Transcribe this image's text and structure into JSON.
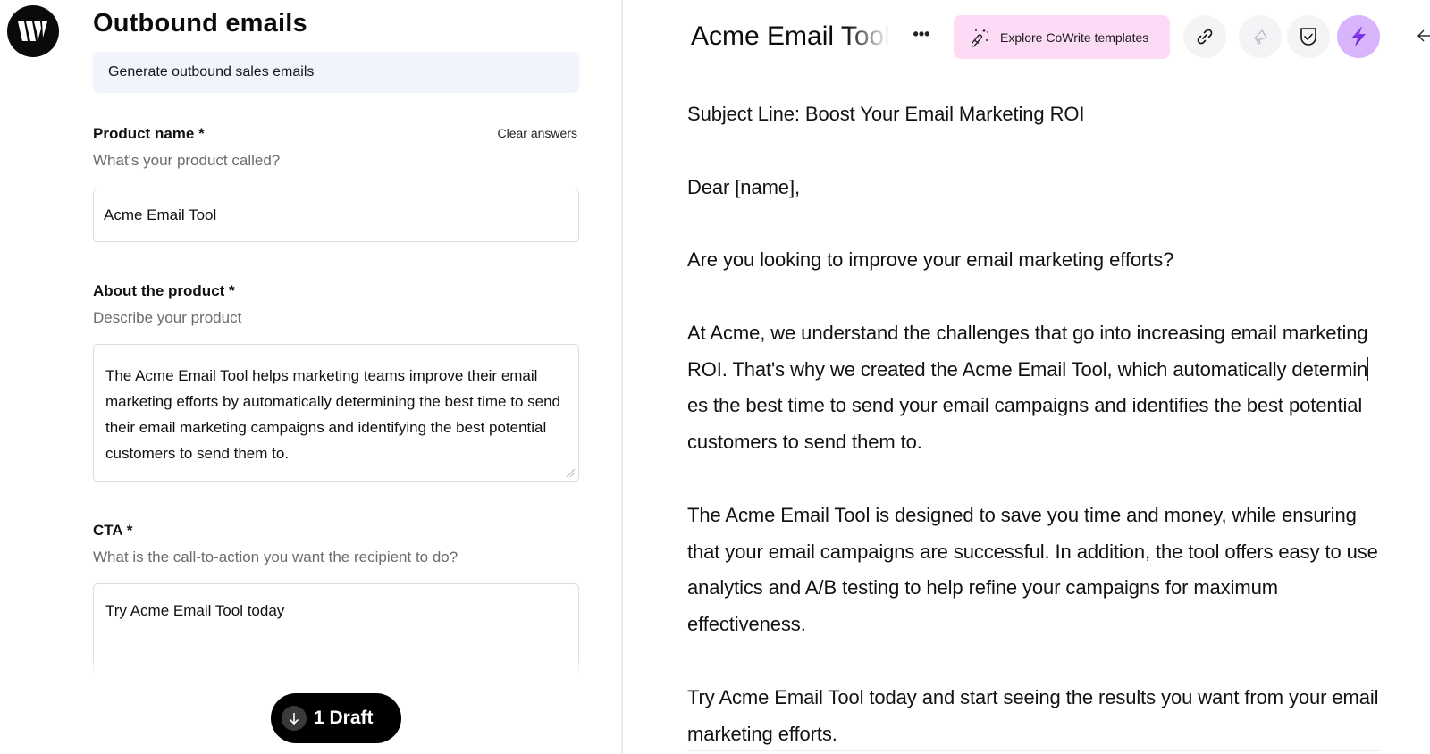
{
  "app": {
    "logo_letter": "W"
  },
  "left_panel": {
    "title": "Outbound emails",
    "description": "Generate outbound sales emails",
    "clear_answers_label": "Clear answers",
    "fields": [
      {
        "label": "Product name *",
        "hint": "What's your product called?",
        "value": "Acme Email Tool"
      },
      {
        "label": "About the product *",
        "hint": "Describe your product",
        "value": "The Acme Email Tool helps marketing teams improve their email marketing efforts by automatically determining the best time to send their email marketing campaigns and identifying the best potential customers to send them to."
      },
      {
        "label": "CTA *",
        "hint": "What is the call-to-action you want the recipient to do?",
        "value": "Try Acme Email Tool today"
      }
    ],
    "draft_button": {
      "icon": "arrow-down-icon",
      "label": "1 Draft"
    }
  },
  "right_panel": {
    "doc_title": "Acme Email Tool",
    "more_label": "•••",
    "templates_button": {
      "icon": "magic-wand-icon",
      "label": "Explore CoWrite templates"
    },
    "toolbar_icons": [
      "link-icon",
      "megaphone-icon",
      "shield-check-icon",
      "lightning-bolt-icon",
      "arrow-left-icon"
    ],
    "colors": {
      "templates_bg": "#fddaf6",
      "bolt_bg": "#d8b4fb",
      "bolt_fg": "#7c2ae8",
      "circle_bg": "#f4f4f7"
    },
    "email": {
      "subject": "Subject Line: Boost Your Email Marketing ROI",
      "greeting": "Dear [name],",
      "paragraph_1": "Are you looking to improve your email marketing efforts?",
      "paragraph_2_before_caret": "At Acme, we understand the challenges that go into increasing email marketing ROI. That's why we created the Acme Email Tool, which automatically determin",
      "paragraph_2_after_caret": "es the best time to send your email campaigns and identifies the best potential customers to send them to.",
      "paragraph_3": "The Acme Email Tool is designed to save you time and money, while ensuring that your email campaigns are successful. In addition, the tool offers easy to use analytics and A/B testing to help refine your campaigns for maximum effectiveness.",
      "paragraph_4": "Try Acme Email Tool today and start seeing the results you want from your email marketing efforts."
    }
  }
}
